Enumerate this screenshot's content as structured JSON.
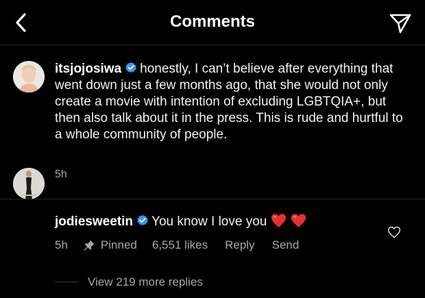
{
  "header": {
    "title": "Comments"
  },
  "caption": {
    "username": "itsjojosiwa",
    "text": "honestly, I can’t believe after everything that went down just a few months ago, that she would not only create a movie with intention of excluding LGBTQIA+, but then also talk about it in the press. This is rude and hurtful to a whole community of people.",
    "time": "5h"
  },
  "comment": {
    "username": "jodiesweetin",
    "text": "You know I love you",
    "emoji": [
      "red-heart",
      "red-heart"
    ],
    "time": "5h",
    "pinned_label": "Pinned",
    "likes": "6,551 likes",
    "reply_label": "Reply",
    "send_label": "Send"
  },
  "replies": {
    "label": "View 219 more replies"
  },
  "colors": {
    "background": "#000000",
    "verified": "#3897f0",
    "heart": "#ed4956",
    "muted": "#a8a8a8"
  }
}
